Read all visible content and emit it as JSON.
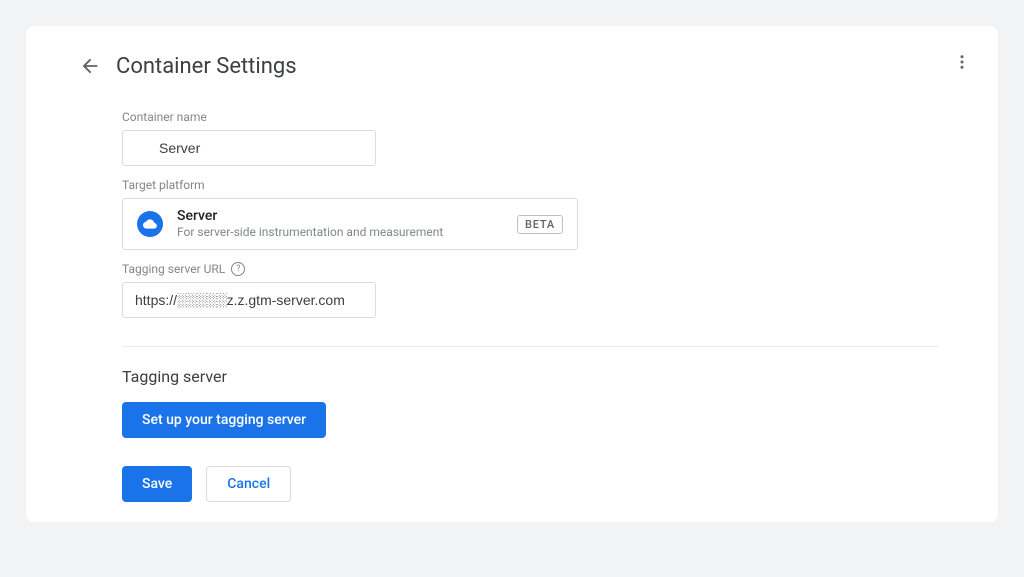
{
  "header": {
    "title": "Container Settings"
  },
  "container_name": {
    "label": "Container name",
    "value": "Server"
  },
  "target_platform": {
    "label": "Target platform",
    "name": "Server",
    "desc": "For server-side instrumentation and measurement",
    "badge": "BETA"
  },
  "tagging_url": {
    "label": "Tagging server URL",
    "value": "https://░░░░░z.z.gtm-server.com"
  },
  "tagging_server": {
    "section_title": "Tagging server",
    "setup_label": "Set up your tagging server"
  },
  "actions": {
    "save": "Save",
    "cancel": "Cancel"
  }
}
